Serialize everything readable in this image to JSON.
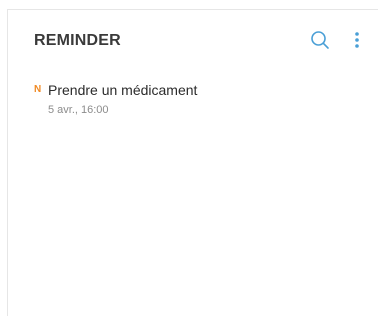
{
  "header": {
    "title": "REMINDER",
    "search_icon": "search-icon",
    "more_icon": "more-vertical-icon"
  },
  "reminders": [
    {
      "badge": "N",
      "title": "Prendre un médicament",
      "time": "5 avr., 16:00"
    }
  ],
  "colors": {
    "accent": "#4a9fd6",
    "badge": "#f08a24",
    "title_text": "#3a3a3a",
    "secondary_text": "#8c8c8c"
  }
}
